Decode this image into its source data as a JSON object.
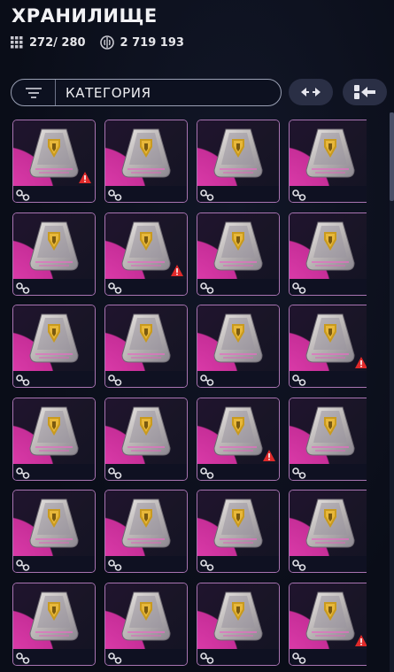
{
  "header": {
    "title": "ХРАНИЛИЩЕ",
    "capacity_label": "272/ 280",
    "credits_label": "2 719 193",
    "capacity_icon": "grid-icon",
    "credits_icon": "credits-icon"
  },
  "search": {
    "filter_icon": "filter-icon",
    "category_label": "КАТЕГОРИЯ"
  },
  "toolbar": {
    "collapse_icon": "collapse-arrows-icon",
    "move_icon": "move-to-slot-icon"
  },
  "colors": {
    "accent_magenta": "#d43aa6",
    "tile_border": "#a974b2",
    "warning_red": "#e02a2a",
    "background": "#0b0e1a"
  },
  "items": [
    {
      "name": "relic-pod",
      "warning": true
    },
    {
      "name": "relic-pod",
      "warning": false
    },
    {
      "name": "relic-pod",
      "warning": false
    },
    {
      "name": "relic-pod",
      "warning": false
    },
    {
      "name": "relic-pod",
      "warning": false
    },
    {
      "name": "relic-pod",
      "warning": true
    },
    {
      "name": "relic-pod",
      "warning": false
    },
    {
      "name": "relic-pod",
      "warning": false
    },
    {
      "name": "relic-pod",
      "warning": false
    },
    {
      "name": "relic-pod",
      "warning": false
    },
    {
      "name": "relic-pod",
      "warning": false
    },
    {
      "name": "relic-pod",
      "warning": true
    },
    {
      "name": "relic-pod",
      "warning": false
    },
    {
      "name": "relic-pod",
      "warning": false
    },
    {
      "name": "relic-pod",
      "warning": true
    },
    {
      "name": "relic-pod",
      "warning": false
    },
    {
      "name": "relic-pod",
      "warning": false
    },
    {
      "name": "relic-pod",
      "warning": false
    },
    {
      "name": "relic-pod",
      "warning": false
    },
    {
      "name": "relic-pod",
      "warning": false
    },
    {
      "name": "relic-pod",
      "warning": false
    },
    {
      "name": "relic-pod",
      "warning": false
    },
    {
      "name": "relic-pod",
      "warning": false
    },
    {
      "name": "relic-pod",
      "warning": true
    }
  ]
}
